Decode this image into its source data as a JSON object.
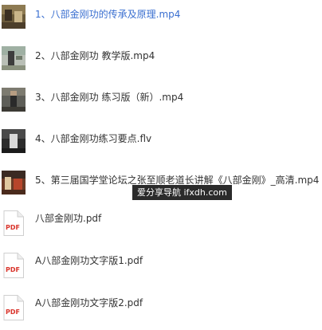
{
  "files": [
    {
      "name": "1、八部金刚功的传承及原理.mp4",
      "kind": "video",
      "selected": true
    },
    {
      "name": "2、八部金刚功 教学版.mp4",
      "kind": "video",
      "selected": false
    },
    {
      "name": "3、八部金刚功 练习版（新）.mp4",
      "kind": "video",
      "selected": false
    },
    {
      "name": "4、八部金刚功练习要点.flv",
      "kind": "video",
      "selected": false
    },
    {
      "name": "5、第三届国学堂论坛之张至顺老道长讲解《八部金刚》_高清.mp4",
      "kind": "video",
      "selected": false
    },
    {
      "name": "八部金刚功.pdf",
      "kind": "pdf",
      "selected": false
    },
    {
      "name": "A八部金刚功文字版1.pdf",
      "kind": "pdf",
      "selected": false
    },
    {
      "name": "A八部金刚功文字版2.pdf",
      "kind": "pdf",
      "selected": false
    }
  ],
  "pdf_icon_label": "PDF",
  "watermark": "爱分享导航 ifxdh.com",
  "colors": {
    "selected_text": "#3a6fd0",
    "text": "#333333",
    "pdf_red": "#d9342b"
  }
}
